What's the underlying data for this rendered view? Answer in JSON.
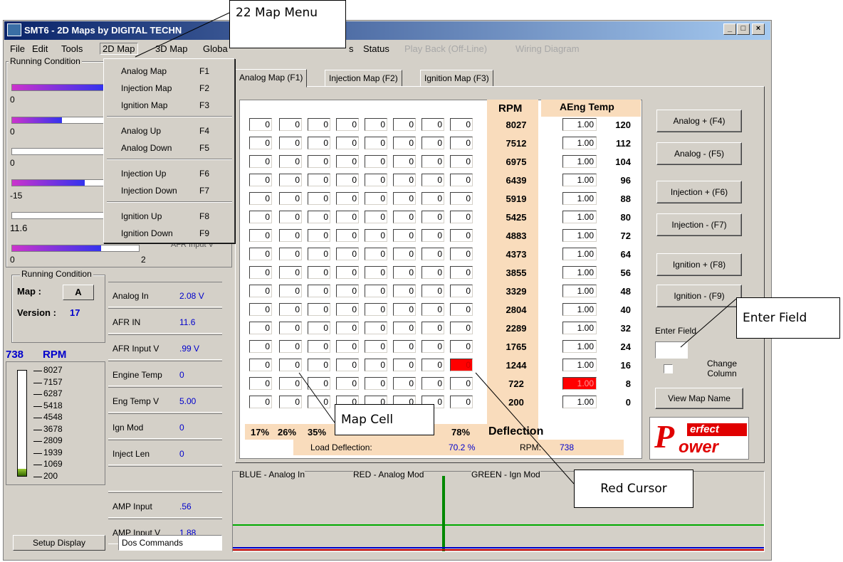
{
  "window": {
    "title": "SMT6 - 2D Maps  by DIGITAL TECHN",
    "controls": [
      "_",
      "□",
      "×"
    ]
  },
  "menu": {
    "items": [
      "File",
      "Edit",
      "Tools",
      "2D Map",
      "3D Map",
      "Globa",
      "s",
      "Status",
      "Play Back (Off-Line)",
      "Wiring Diagram"
    ]
  },
  "dropdown": {
    "items": [
      {
        "label": "Analog Map",
        "key": "F1"
      },
      {
        "label": "Injection Map",
        "key": "F2"
      },
      {
        "label": "Ignition Map",
        "key": "F3"
      },
      {
        "label": "Analog Up",
        "key": "F4"
      },
      {
        "label": "Analog Down",
        "key": "F5"
      },
      {
        "label": "Injection Up",
        "key": "F6"
      },
      {
        "label": "Injection Down",
        "key": "F7"
      },
      {
        "label": "Ignition Up",
        "key": "F8"
      },
      {
        "label": "Ignition Down",
        "key": "F9"
      }
    ]
  },
  "running_conditions": {
    "title": "Running Condition",
    "bars": [
      {
        "value": "0",
        "fill_pct": 100
      },
      {
        "value": "0",
        "fill_pct": 55
      },
      {
        "value": "0",
        "fill_pct": 0
      },
      {
        "value": "-15",
        "fill_pct": 80
      },
      {
        "value": "11.6",
        "fill_pct": 0
      },
      {
        "value": "0",
        "fill_pct": 100
      }
    ],
    "extra_value": "2",
    "partial_label": "AFR Input V"
  },
  "running_condition_box": {
    "title": "Running Condition",
    "map_label": "Map :",
    "map_value": "A",
    "version_label": "Version :",
    "version_value": "17"
  },
  "rpm_display": {
    "value": "738",
    "unit": "RPM",
    "scale": [
      "8027",
      "7157",
      "6287",
      "5418",
      "4548",
      "3678",
      "2809",
      "1939",
      "1069",
      "200"
    ]
  },
  "info_panel": [
    {
      "label": "Analog In",
      "value": "2.08 V"
    },
    {
      "label": "AFR IN",
      "value": "11.6"
    },
    {
      "label": "AFR Input V",
      "value": ".99 V"
    },
    {
      "label": "Engine Temp",
      "value": "0"
    },
    {
      "label": "Eng Temp V",
      "value": "5.00"
    },
    {
      "label": "Ign Mod",
      "value": "0"
    },
    {
      "label": "Inject Len",
      "value": "0"
    },
    {
      "label": "",
      "value": ""
    },
    {
      "label": "AMP Input",
      "value": ".56"
    },
    {
      "label": "AMP Input V",
      "value": "1.88"
    }
  ],
  "bottom_left": {
    "setup_button": "Setup Display",
    "dos_commands": "Dos Commands"
  },
  "tabs": [
    "Analog Map (F1)",
    "Injection Map (F2)",
    "Ignition Map (F3)"
  ],
  "map": {
    "rpm_header": "RPM",
    "temp_header": "AEng Temp",
    "rpm_values": [
      "8027",
      "7512",
      "6975",
      "6439",
      "5919",
      "5425",
      "4883",
      "4373",
      "3855",
      "3329",
      "2804",
      "2289",
      "1765",
      "1244",
      "722",
      "200"
    ],
    "af_values": [
      "1.00",
      "1.00",
      "1.00",
      "1.00",
      "1.00",
      "1.00",
      "1.00",
      "1.00",
      "1.00",
      "1.00",
      "1.00",
      "1.00",
      "1.00",
      "1.00",
      "1.00",
      "1.00"
    ],
    "temp_values": [
      "120",
      "112",
      "104",
      "96",
      "88",
      "80",
      "72",
      "64",
      "56",
      "48",
      "40",
      "32",
      "24",
      "16",
      "8",
      "0"
    ],
    "cell_value": "0",
    "columns": 8,
    "rows": 16,
    "red_cell": {
      "row": 13,
      "col": 7
    },
    "red_af_row": 14,
    "load_labels": [
      "17%",
      "26%",
      "35%",
      "78%"
    ],
    "deflection_label": "Deflection",
    "load_deflection_label": "Load Deflection:",
    "load_deflection_value": "70.2 %",
    "rpm_label": "RPM:",
    "rpm_value": "738"
  },
  "buttons": [
    "Analog + (F4)",
    "Analog - (F5)",
    "Injection + (F6)",
    "Injection - (F7)",
    "Ignition + (F8)",
    "Ignition - (F9)"
  ],
  "enter_field": {
    "label": "Enter Field",
    "change_column": "Change Column",
    "view_map_name": "View Map Name"
  },
  "logo": {
    "line1": "erfect",
    "line2": "ower"
  },
  "graph": {
    "legend_blue": "BLUE - Analog In",
    "legend_red": "RED - Analog Mod",
    "legend_green": "GREEN - Ign Mod"
  },
  "callouts": {
    "map_menu": "22 Map Menu",
    "enter_field": "Enter Field",
    "map_cell": "Map Cell",
    "red_cursor": "Red Cursor"
  },
  "colors": {
    "title_start": "#0a246a",
    "title_end": "#a6caf0",
    "peach": "#f9dcbc",
    "cursor_red": "#ff0000",
    "value_blue": "#0000cc",
    "graph_green": "#00aa00"
  }
}
